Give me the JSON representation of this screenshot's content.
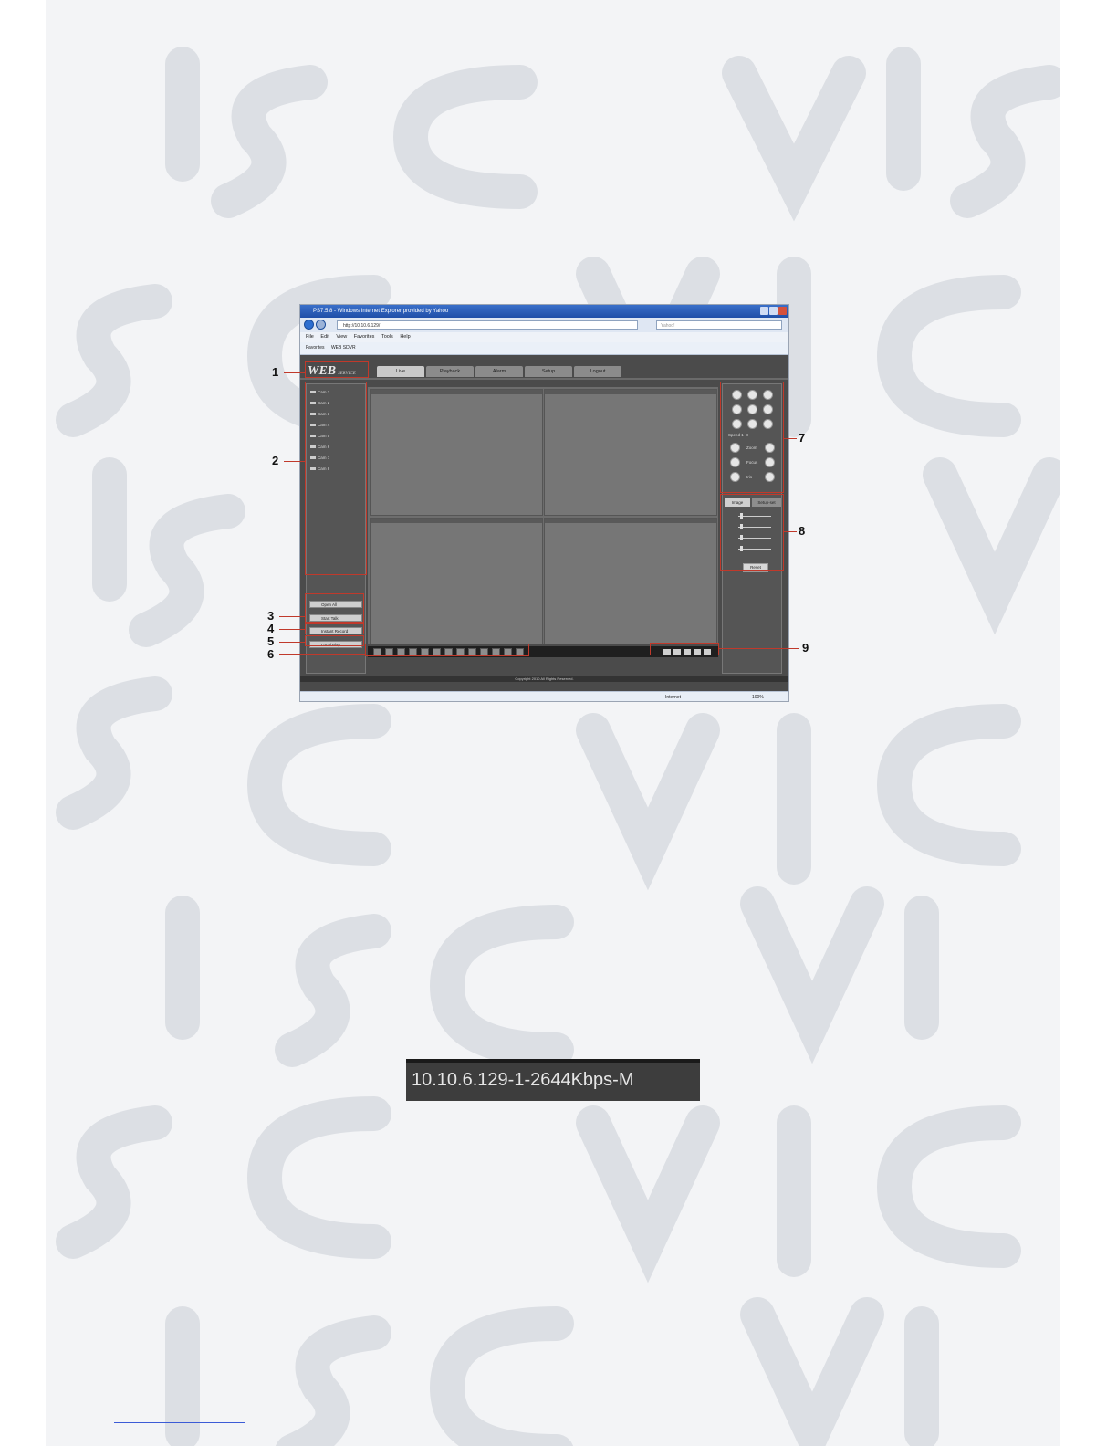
{
  "browser": {
    "title": "PS7.5.8 - Windows Internet Explorer provided by Yahoo",
    "url": "http://10.10.6.129/",
    "search_placeholder": "Yahoo!",
    "menu": [
      "File",
      "Edit",
      "View",
      "Favorites",
      "Tools",
      "Help"
    ],
    "favorites": [
      "Favorites",
      "WEB SDVR"
    ],
    "status": "Internet",
    "zoom": "100%"
  },
  "web": {
    "logo": "WEB",
    "logo_sub": "SERVICE",
    "tabs": [
      "Live",
      "Playback",
      "Alarm",
      "Setup",
      "Logout"
    ],
    "channels": [
      "Cam 1",
      "Cam 2",
      "Cam 3",
      "Cam 4",
      "Cam 5",
      "Cam 6",
      "Cam 7",
      "Cam 8"
    ],
    "left_buttons": [
      "Open All",
      "Start Talk",
      "Instant Record",
      "Local Play"
    ],
    "ptz_speed": "Speed 1~8",
    "ptz_labels": [
      "Zoom",
      "Focus",
      "Iris"
    ],
    "right_tabs": [
      "Image",
      "Setup-set"
    ],
    "reset": "Reset",
    "copyright": "Copyright 2010 All Rights Reserved."
  },
  "callouts": [
    "1",
    "2",
    "3",
    "4",
    "5",
    "6",
    "7",
    "8",
    "9"
  ],
  "status_text": "10.10.6.129-1-2644Kbps-M"
}
